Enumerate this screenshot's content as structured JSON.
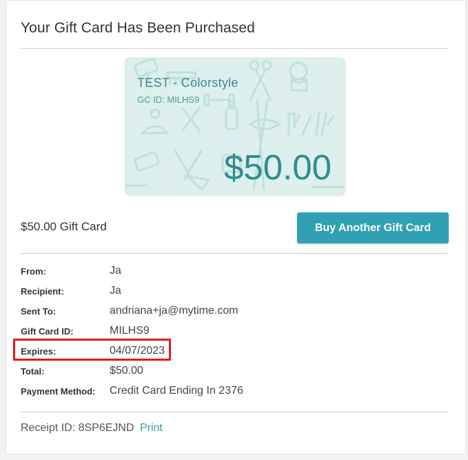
{
  "page": {
    "title": "Your Gift Card Has Been Purchased"
  },
  "gift_card": {
    "name": "TEST - Colorstyle",
    "id_label": "GC ID: MILHS9",
    "amount": "$50.00",
    "colors": {
      "background": "#ddf0ee",
      "accent": "#2f8c91"
    },
    "pattern_icons": [
      "scissors-icon",
      "hair-dryer-icon",
      "comb-icon",
      "dog-icon",
      "bottle-icon",
      "lips-icon",
      "gloves-icon",
      "meditation-icon",
      "tools-icon",
      "broom-icon",
      "dumbbell-icon"
    ]
  },
  "summary": {
    "label": "$50.00 Gift Card",
    "buy_button": "Buy Another Gift Card",
    "button_color": "#32a0b4"
  },
  "details": [
    {
      "key": "From:",
      "value": "Ja"
    },
    {
      "key": "Recipient:",
      "value": "Ja"
    },
    {
      "key": "Sent To:",
      "value": "andriana+ja@mytime.com"
    },
    {
      "key": "Gift Card ID:",
      "value": "MILHS9"
    },
    {
      "key": "Expires:",
      "value": "04/07/2023"
    },
    {
      "key": "Total:",
      "value": "$50.00"
    },
    {
      "key": "Payment Method:",
      "value": "Credit Card Ending In 2376"
    }
  ],
  "receipt": {
    "label": "Receipt ID: 8SP6EJND",
    "print_label": "Print"
  },
  "highlight_color": "#e3191c"
}
